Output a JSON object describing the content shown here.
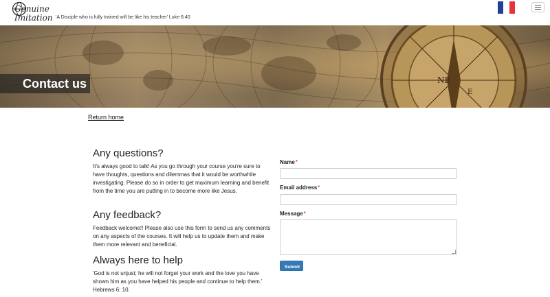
{
  "header": {
    "logo": {
      "line1": "Genuine",
      "line2": "Imitation"
    },
    "tagline": "'A Disciple who is fully trained will be like his teacher' Luke 6:40",
    "language_flag": {
      "icon": "french-flag-icon",
      "colors": [
        "#1f3f99",
        "#ffffff",
        "#e8333d"
      ]
    },
    "menu_icon": "hamburger-menu-icon"
  },
  "banner": {
    "title": "Contact us",
    "image": "antique-world-map-with-compass"
  },
  "return_link": "Return home",
  "sections": [
    {
      "heading": "Any questions?",
      "body": "It's always good to talk! As you go through your course you're sure to have thoughts, questions and dilemmas that it would be worthwhile investigating. Please do so in order to get maximum learning and benefit from the time you are putting in to become more like Jesus."
    },
    {
      "heading": "Any feedback?",
      "body": "Feedback welcome!! Please also use this form to send us any comments on any aspects of the courses.  It will help us to update them and make them more relevant and beneficial."
    },
    {
      "heading": "Always here to help",
      "body": "'God is not unjust; he will not forget your work and the love you have shown him as you have helped his people and continue to help them.' Hebrews 6: 10."
    }
  ],
  "form": {
    "name_label": "Name",
    "email_label": "Email address",
    "message_label": "Message",
    "required_marker": "*",
    "name_value": "",
    "email_value": "",
    "message_value": "",
    "submit_label": "Submit"
  },
  "colors": {
    "accent": "#337ab7",
    "required": "#cc0000"
  }
}
